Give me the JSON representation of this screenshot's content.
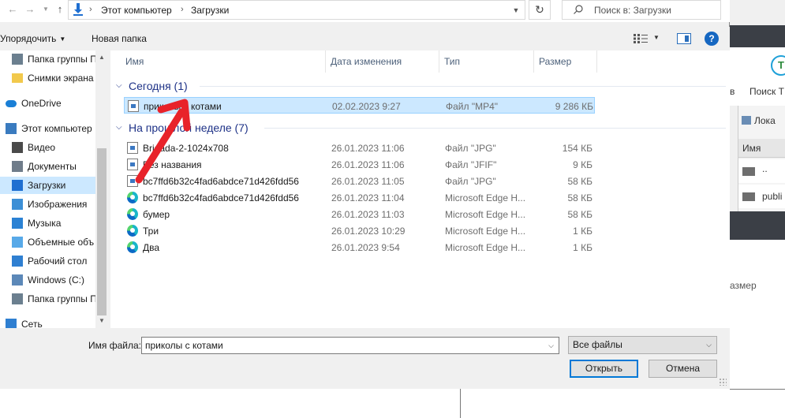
{
  "address": {
    "crumbs": [
      "Этот компьютер",
      "Загрузки"
    ],
    "search_placeholder": "Поиск в: Загрузки"
  },
  "toolbar": {
    "organize_label": "Упорядочить",
    "new_folder_label": "Новая папка"
  },
  "nav": {
    "items": [
      {
        "label": "Папка группы П",
        "icon": "network-folder-icon"
      },
      {
        "label": "Снимки экрана",
        "icon": "folder-icon"
      },
      {
        "label": "OneDrive",
        "icon": "cloud-icon"
      },
      {
        "label": "Этот компьютер",
        "icon": "computer-icon"
      },
      {
        "label": "Видео",
        "icon": "video-icon"
      },
      {
        "label": "Документы",
        "icon": "documents-icon"
      },
      {
        "label": "Загрузки",
        "icon": "downloads-icon",
        "selected": true
      },
      {
        "label": "Изображения",
        "icon": "pictures-icon"
      },
      {
        "label": "Музыка",
        "icon": "music-icon"
      },
      {
        "label": "Объемные объ",
        "icon": "3d-objects-icon"
      },
      {
        "label": "Рабочий стол",
        "icon": "desktop-icon"
      },
      {
        "label": "Windows (C:)",
        "icon": "drive-icon"
      },
      {
        "label": "Папка группы П",
        "icon": "network-folder-icon"
      },
      {
        "label": "Сеть",
        "icon": "network-icon"
      }
    ]
  },
  "columns": {
    "name": "Имя",
    "date": "Дата изменения",
    "type": "Тип",
    "size": "Размер"
  },
  "groups": {
    "today": {
      "label": "Сегодня (1)",
      "files": [
        {
          "name": "приколы с котами",
          "date": "02.02.2023 9:27",
          "type": "Файл \"MP4\"",
          "size": "9 286 КБ",
          "icon": "file"
        }
      ]
    },
    "last_week": {
      "label": "На прошлой неделе (7)",
      "files": [
        {
          "name": "Brigada-2-1024x708",
          "date": "26.01.2023 11:06",
          "type": "Файл \"JPG\"",
          "size": "154 КБ",
          "icon": "file"
        },
        {
          "name": "Без названия",
          "date": "26.01.2023 11:06",
          "type": "Файл \"JFIF\"",
          "size": "9 КБ",
          "icon": "file"
        },
        {
          "name": "bc7ffd6b32c4fad6abdce71d426fdd56",
          "date": "26.01.2023 11:05",
          "type": "Файл \"JPG\"",
          "size": "58 КБ",
          "icon": "file"
        },
        {
          "name": "bc7ffd6b32c4fad6abdce71d426fdd56",
          "date": "26.01.2023 11:04",
          "type": "Microsoft Edge H...",
          "size": "58 КБ",
          "icon": "edge"
        },
        {
          "name": "бумер",
          "date": "26.01.2023 11:03",
          "type": "Microsoft Edge H...",
          "size": "58 КБ",
          "icon": "edge"
        },
        {
          "name": "Три",
          "date": "26.01.2023 10:29",
          "type": "Microsoft Edge H...",
          "size": "1 КБ",
          "icon": "edge"
        },
        {
          "name": "Два",
          "date": "26.01.2023 9:54",
          "type": "Microsoft Edge H...",
          "size": "1 КБ",
          "icon": "edge"
        }
      ]
    }
  },
  "bottom": {
    "filename_label": "Имя файла:",
    "filename_value": "приколы с котами",
    "filetype_value": "Все файлы",
    "open_label": "Открыть",
    "cancel_label": "Отмена"
  },
  "background_app": {
    "logo_letter": "T",
    "toolbar_fragment": "в",
    "search_fragment": "Поиск T",
    "location_fragment": "Лока",
    "column_name": "Имя",
    "row1": "..",
    "row2": "publi",
    "size_fragment": "азмер"
  },
  "colors": {
    "accent": "#0078d7",
    "selection": "#cce8ff",
    "group_header": "#1e3287",
    "annotation_arrow": "#e8232a"
  }
}
